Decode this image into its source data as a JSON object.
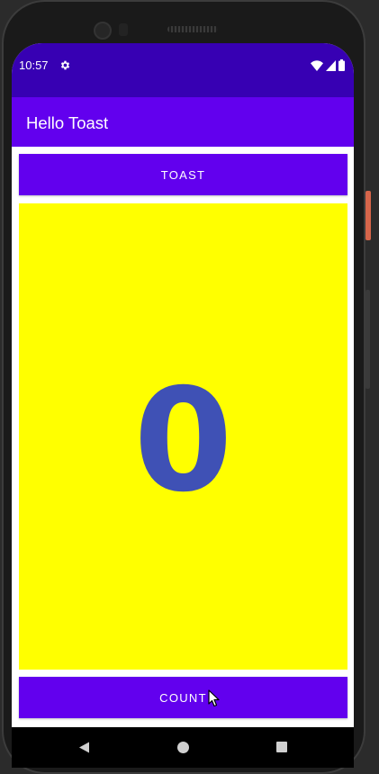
{
  "status_bar": {
    "time": "10:57",
    "icons": [
      "settings-gear-icon",
      "wifi-icon",
      "cell-signal-icon",
      "battery-icon"
    ]
  },
  "app_bar": {
    "title": "Hello Toast"
  },
  "toast_button": {
    "label": "TOAST"
  },
  "count_display": {
    "value": "0"
  },
  "count_button": {
    "label": "COUNT"
  },
  "nav_bar": {
    "icons": [
      "back-icon",
      "home-icon",
      "recents-icon"
    ]
  },
  "colors": {
    "status_bar": "#3700b3",
    "primary": "#6200ee",
    "count_background": "#ffff00",
    "count_text": "#3f51b5"
  }
}
